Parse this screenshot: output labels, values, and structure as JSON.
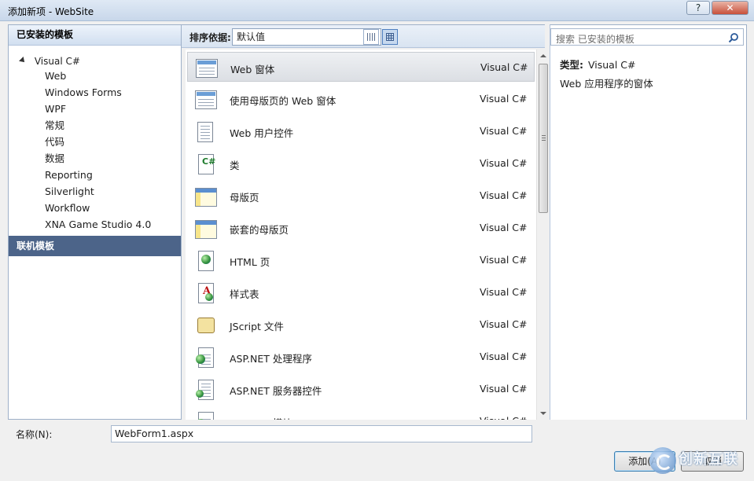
{
  "window": {
    "title": "添加新项 - WebSite",
    "help_label": "?",
    "close_label": "✕"
  },
  "left_pane": {
    "header": "已安装的模板",
    "tree_root": "Visual C#",
    "tree_items": [
      "Web",
      "Windows Forms",
      "WPF",
      "常规",
      "代码",
      "数据",
      "Reporting",
      "Silverlight",
      "Workflow",
      "XNA Game Studio 4.0"
    ],
    "online_templates": "联机模板"
  },
  "toolbar": {
    "sort_label": "排序依据:",
    "sort_value": "默认值"
  },
  "templates": [
    {
      "name": "Web 窗体",
      "lang": "Visual C#",
      "icon": "web-form-icon"
    },
    {
      "name": "使用母版页的 Web 窗体",
      "lang": "Visual C#",
      "icon": "web-form-master-icon"
    },
    {
      "name": "Web 用户控件",
      "lang": "Visual C#",
      "icon": "user-control-icon"
    },
    {
      "name": "类",
      "lang": "Visual C#",
      "icon": "class-icon"
    },
    {
      "name": "母版页",
      "lang": "Visual C#",
      "icon": "master-page-icon"
    },
    {
      "name": "嵌套的母版页",
      "lang": "Visual C#",
      "icon": "nested-master-page-icon"
    },
    {
      "name": "HTML 页",
      "lang": "Visual C#",
      "icon": "html-page-icon"
    },
    {
      "name": "样式表",
      "lang": "Visual C#",
      "icon": "stylesheet-icon"
    },
    {
      "name": "JScript 文件",
      "lang": "Visual C#",
      "icon": "jscript-icon"
    },
    {
      "name": "ASP.NET 处理程序",
      "lang": "Visual C#",
      "icon": "handler-icon"
    },
    {
      "name": "ASP.NET 服务器控件",
      "lang": "Visual C#",
      "icon": "server-control-icon"
    },
    {
      "name": "ASP.NET 模块",
      "lang": "Visual C#",
      "icon": "module-icon"
    }
  ],
  "right_pane": {
    "search_placeholder": "搜索 已安装的模板",
    "type_label": "类型:",
    "type_value": "Visual C#",
    "description": "Web 应用程序的窗体"
  },
  "bottom": {
    "name_label": "名称(N):",
    "name_value": "WebForm1.aspx",
    "add_button": "添加(A)",
    "cancel_button": "取消"
  },
  "watermark": {
    "text": "创新互联"
  }
}
